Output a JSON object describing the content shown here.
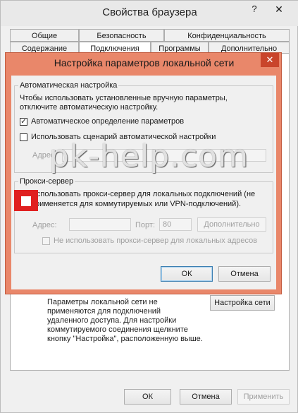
{
  "outer": {
    "title": "Свойства браузера",
    "help": "?",
    "close": "✕",
    "tabs_row1": [
      "Общие",
      "Безопасность",
      "Конфиденциальность"
    ],
    "tabs_row2": [
      "Содержание",
      "Подключения",
      "Программы",
      "Дополнительно"
    ],
    "lan_note": "Параметры локальной сети не применяются для подключений удаленного доступа. Для настройки коммутируемого соединения щелкните кнопку \"Настройка\", расположенную выше.",
    "lan_settings_button": "Настройка сети",
    "ok": "ОК",
    "cancel": "Отмена",
    "apply": "Применить"
  },
  "inner": {
    "title": "Настройка параметров локальной сети",
    "close": "✕",
    "auto": {
      "group_label": "Автоматическая настройка",
      "description": "Чтобы использовать установленные вручную параметры, отключите автоматическую настройку.",
      "auto_detect_label": "Автоматическое определение параметров",
      "auto_detect_checked": true,
      "script_label": "Использовать сценарий автоматической настройки",
      "script_checked": false,
      "address_label": "Адрес"
    },
    "proxy": {
      "group_label": "Прокси-сервер",
      "use_proxy_line1": "Использовать прокси-сервер для локальных подключений (не",
      "use_proxy_line2": "применяется для коммутируемых или VPN-подключений).",
      "use_proxy_checked": false,
      "address_label": "Адрес:",
      "port_label": "Порт:",
      "port_value": "80",
      "advanced_button": "Дополнительно",
      "bypass_label": "Не использовать прокси-сервер для локальных адресов",
      "bypass_checked": false
    },
    "ok": "ОК",
    "cancel": "Отмена"
  },
  "watermark": "pk-help.com"
}
